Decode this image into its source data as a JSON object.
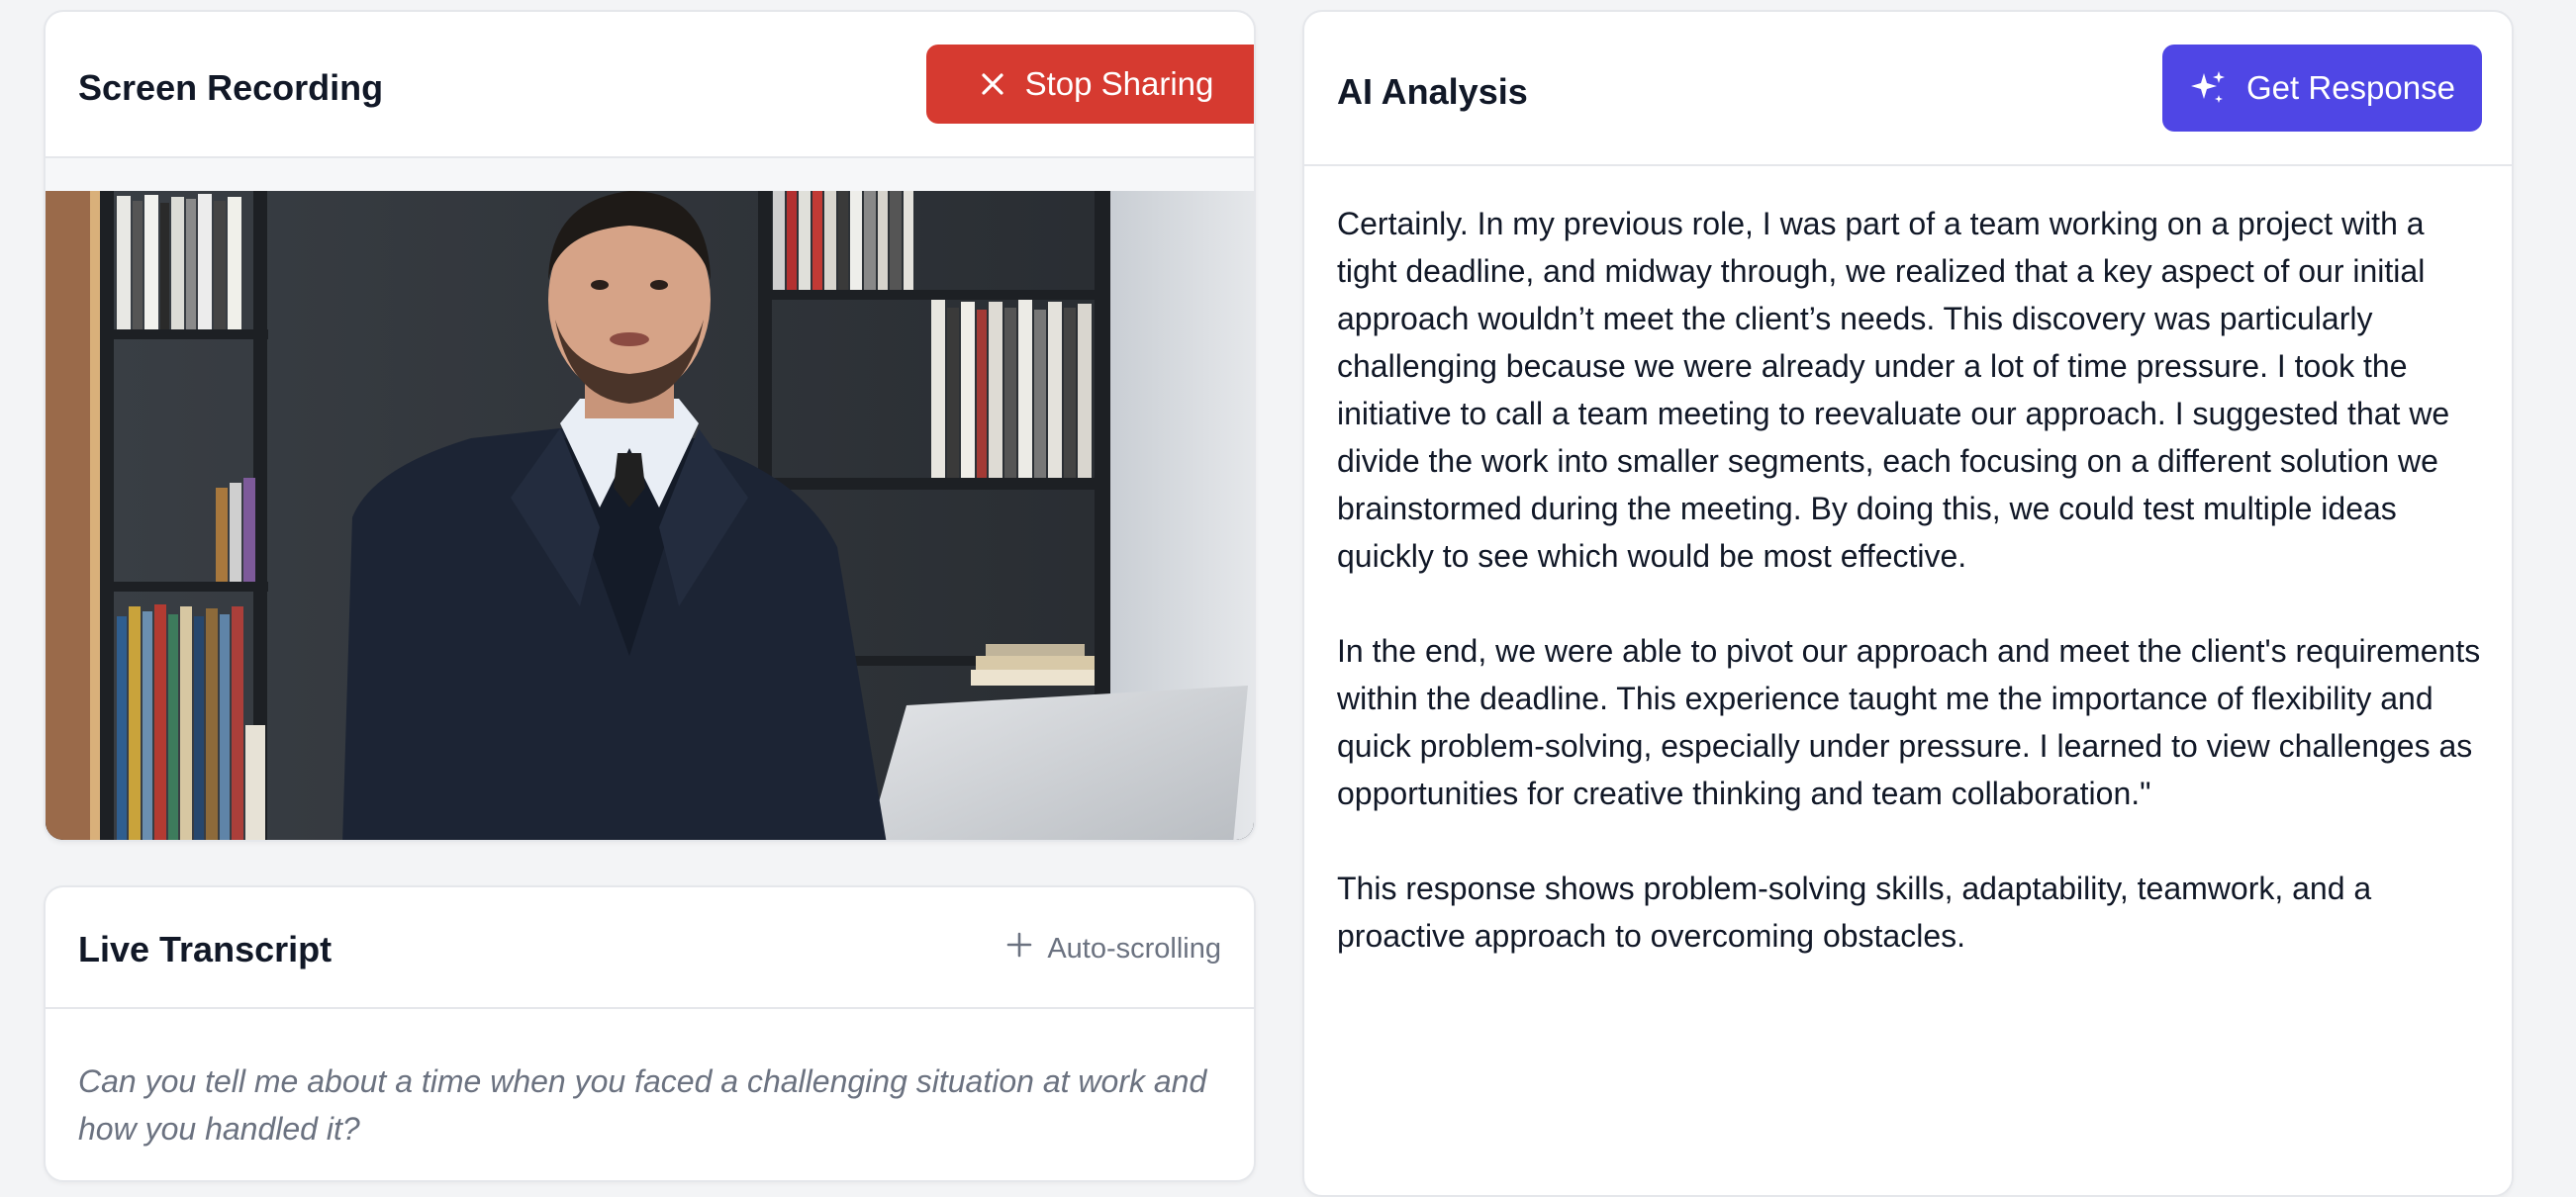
{
  "recording": {
    "title": "Screen Recording",
    "stop_label": "Stop Sharing",
    "stop_icon": "close-icon",
    "colors": {
      "stop_button": "#d63a30"
    }
  },
  "transcript": {
    "title": "Live Transcript",
    "auto_label": "Auto-scrolling",
    "auto_icon": "plus-icon",
    "text": "Can you tell me about a time when you faced a challenging situation at work and how you handled it?"
  },
  "analysis": {
    "title": "AI Analysis",
    "button_label": "Get Response",
    "button_icon": "sparkles-icon",
    "colors": {
      "button": "#4f46e5"
    },
    "paragraphs": [
      "Certainly. In my previous role, I was part of a team working on a project with a tight deadline, and midway through, we realized that a key aspect of our initial approach wouldn’t meet the client’s needs. This discovery was particularly challenging because we were already under a lot of time pressure. I took the initiative to call a team meeting to reevaluate our approach. I suggested that we divide the work into smaller segments, each focusing on a different solution we brainstormed during the meeting. By doing this, we could test multiple ideas quickly to see which would be most effective.",
      "In the end, we were able to pivot our approach and meet the client's requirements within the deadline. This experience taught me the importance of flexibility and quick problem-solving, especially under pressure. I learned to view challenges as opportunities for creative thinking and team collaboration.\"",
      "This response shows problem-solving skills, adaptability, teamwork, and a proactive approach to overcoming obstacles."
    ]
  }
}
